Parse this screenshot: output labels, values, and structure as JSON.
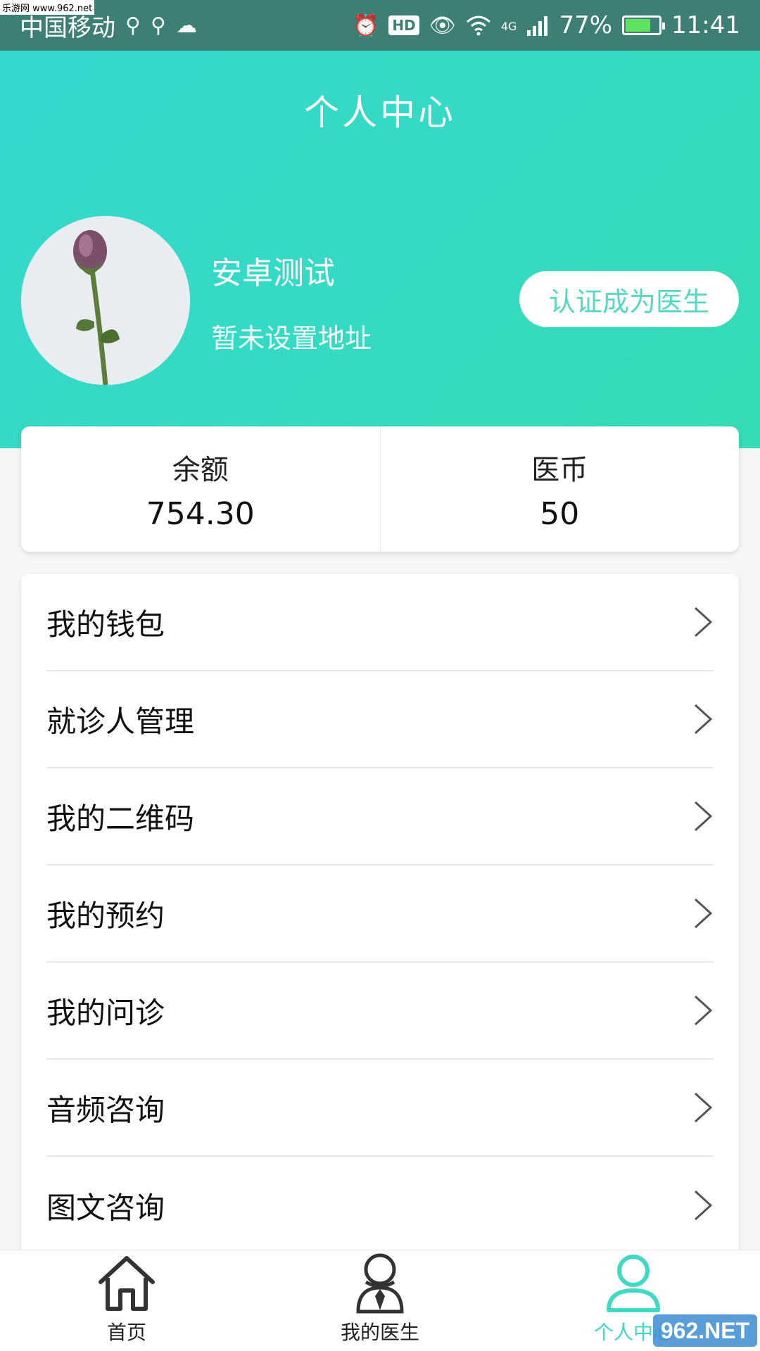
{
  "status_bar": {
    "carrier": "中国移动",
    "network": "4G",
    "battery": "77%",
    "battery_level": 0.77,
    "time": "11:41",
    "hd": "HD"
  },
  "header": {
    "title": "个人中心",
    "user_name": "安卓测试",
    "address": "暂未设置地址",
    "verify_button": "认证成为医生"
  },
  "stats": [
    {
      "label": "余额",
      "value": "754.30"
    },
    {
      "label": "医币",
      "value": "50"
    }
  ],
  "menu": [
    {
      "label": "我的钱包"
    },
    {
      "label": "就诊人管理"
    },
    {
      "label": "我的二维码"
    },
    {
      "label": "我的预约"
    },
    {
      "label": "我的问诊"
    },
    {
      "label": "音频咨询"
    },
    {
      "label": "图文咨询"
    }
  ],
  "tabs": [
    {
      "label": "首页",
      "icon": "home-icon"
    },
    {
      "label": "我的医生",
      "icon": "doctor-icon"
    },
    {
      "label": "个人中心",
      "icon": "user-icon"
    }
  ],
  "colors": {
    "accent": "#3fd9c4",
    "header_start": "#34d8d0",
    "header_end": "#35dcb4",
    "status_bar": "#3d7f74"
  },
  "watermarks": {
    "top": "乐游网 www.962.net",
    "bottom": "962.NET"
  }
}
